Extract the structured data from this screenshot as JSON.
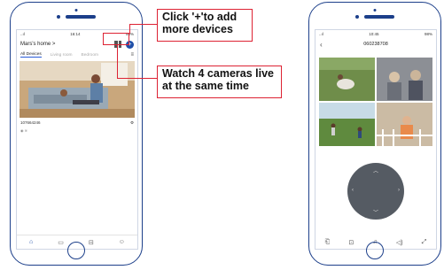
{
  "phone1": {
    "status": {
      "carrier": "..ıl",
      "wifi": "wifi",
      "time": "16:14",
      "battery": "98%"
    },
    "title": "Mars's home >",
    "tabs": [
      "All Devices",
      "Living room",
      "Bedroom"
    ],
    "camera": {
      "id": "107664246"
    },
    "nav": [
      "home-icon",
      "message-icon",
      "cart-icon",
      "profile-icon"
    ]
  },
  "phone2": {
    "status": {
      "carrier": "..ıl",
      "time": "10:45",
      "battery": "98%"
    },
    "title": "060238708"
  },
  "callouts": {
    "add_devices": "Click '+'to add more devices",
    "watch_cameras": "Watch 4 cameras live at the same time"
  },
  "colors": {
    "accent": "#1f4ea8",
    "callout_border": "#dd2233",
    "phone_outline": "#1c3f8a"
  }
}
